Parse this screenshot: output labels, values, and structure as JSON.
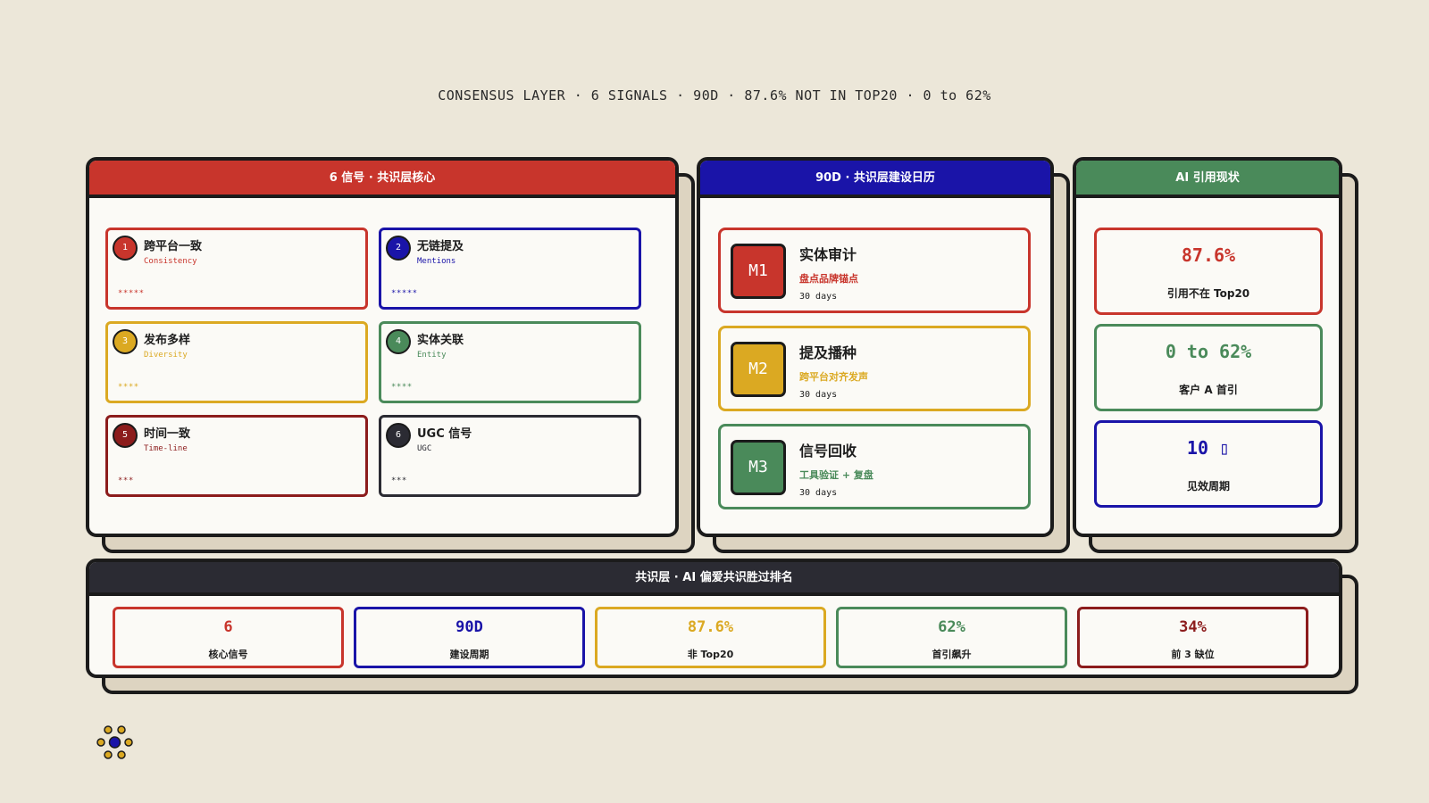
{
  "header": {
    "title": "CONSENSUS LAYER · 6 SIGNALS · 90D · 87.6% NOT IN TOP20 · 0 to 62%"
  },
  "colors": {
    "red": "#c8352c",
    "blue": "#1a14a8",
    "yellow": "#dba922",
    "green": "#4a8a5a",
    "darkred": "#8c1c1c",
    "dark": "#2b2b33"
  },
  "signals_panel": {
    "title": "6 信号 · 共识层核心",
    "items": [
      {
        "num": "1",
        "title": "跨平台一致",
        "sub": "Consistency",
        "stars": "*****",
        "color": "#c8352c"
      },
      {
        "num": "2",
        "title": "无链提及",
        "sub": "Mentions",
        "stars": "*****",
        "color": "#1a14a8"
      },
      {
        "num": "3",
        "title": "发布多样",
        "sub": "Diversity",
        "stars": "****",
        "color": "#dba922"
      },
      {
        "num": "4",
        "title": "实体关联",
        "sub": "Entity",
        "stars": "****",
        "color": "#4a8a5a"
      },
      {
        "num": "5",
        "title": "时间一致",
        "sub": "Time-line",
        "stars": "***",
        "color": "#8c1c1c"
      },
      {
        "num": "6",
        "title": "UGC 信号",
        "sub": "UGC",
        "stars": "***",
        "color": "#2b2b33"
      }
    ]
  },
  "calendar_panel": {
    "title": "90D · 共识层建设日历",
    "items": [
      {
        "badge": "M1",
        "title": "实体审计",
        "sub": "盘点品牌锚点",
        "days": "30 days",
        "color": "#c8352c"
      },
      {
        "badge": "M2",
        "title": "提及播种",
        "sub": "跨平台对齐发声",
        "days": "30 days",
        "color": "#dba922"
      },
      {
        "badge": "M3",
        "title": "信号回收",
        "sub": "工具验证 + 复盘",
        "days": "30 days",
        "color": "#4a8a5a"
      }
    ]
  },
  "ai_panel": {
    "title": "AI 引用现状",
    "items": [
      {
        "value": "87.6%",
        "label": "引用不在 Top20",
        "color": "#c8352c"
      },
      {
        "value": "0 to 62%",
        "label": "客户 A 首引",
        "color": "#4a8a5a"
      },
      {
        "value": "10 ▯",
        "label": "见效周期",
        "color": "#1a14a8"
      }
    ]
  },
  "bottom_panel": {
    "title": "共识层 · AI 偏爱共识胜过排名",
    "items": [
      {
        "value": "6",
        "label": "核心信号",
        "color": "#c8352c"
      },
      {
        "value": "90D",
        "label": "建设周期",
        "color": "#1a14a8"
      },
      {
        "value": "87.6%",
        "label": "非 Top20",
        "color": "#dba922"
      },
      {
        "value": "62%",
        "label": "首引飙升",
        "color": "#4a8a5a"
      },
      {
        "value": "34%",
        "label": "前 3 缺位",
        "color": "#8c1c1c"
      }
    ]
  },
  "logo": {
    "icon": "dots-logo-icon"
  }
}
